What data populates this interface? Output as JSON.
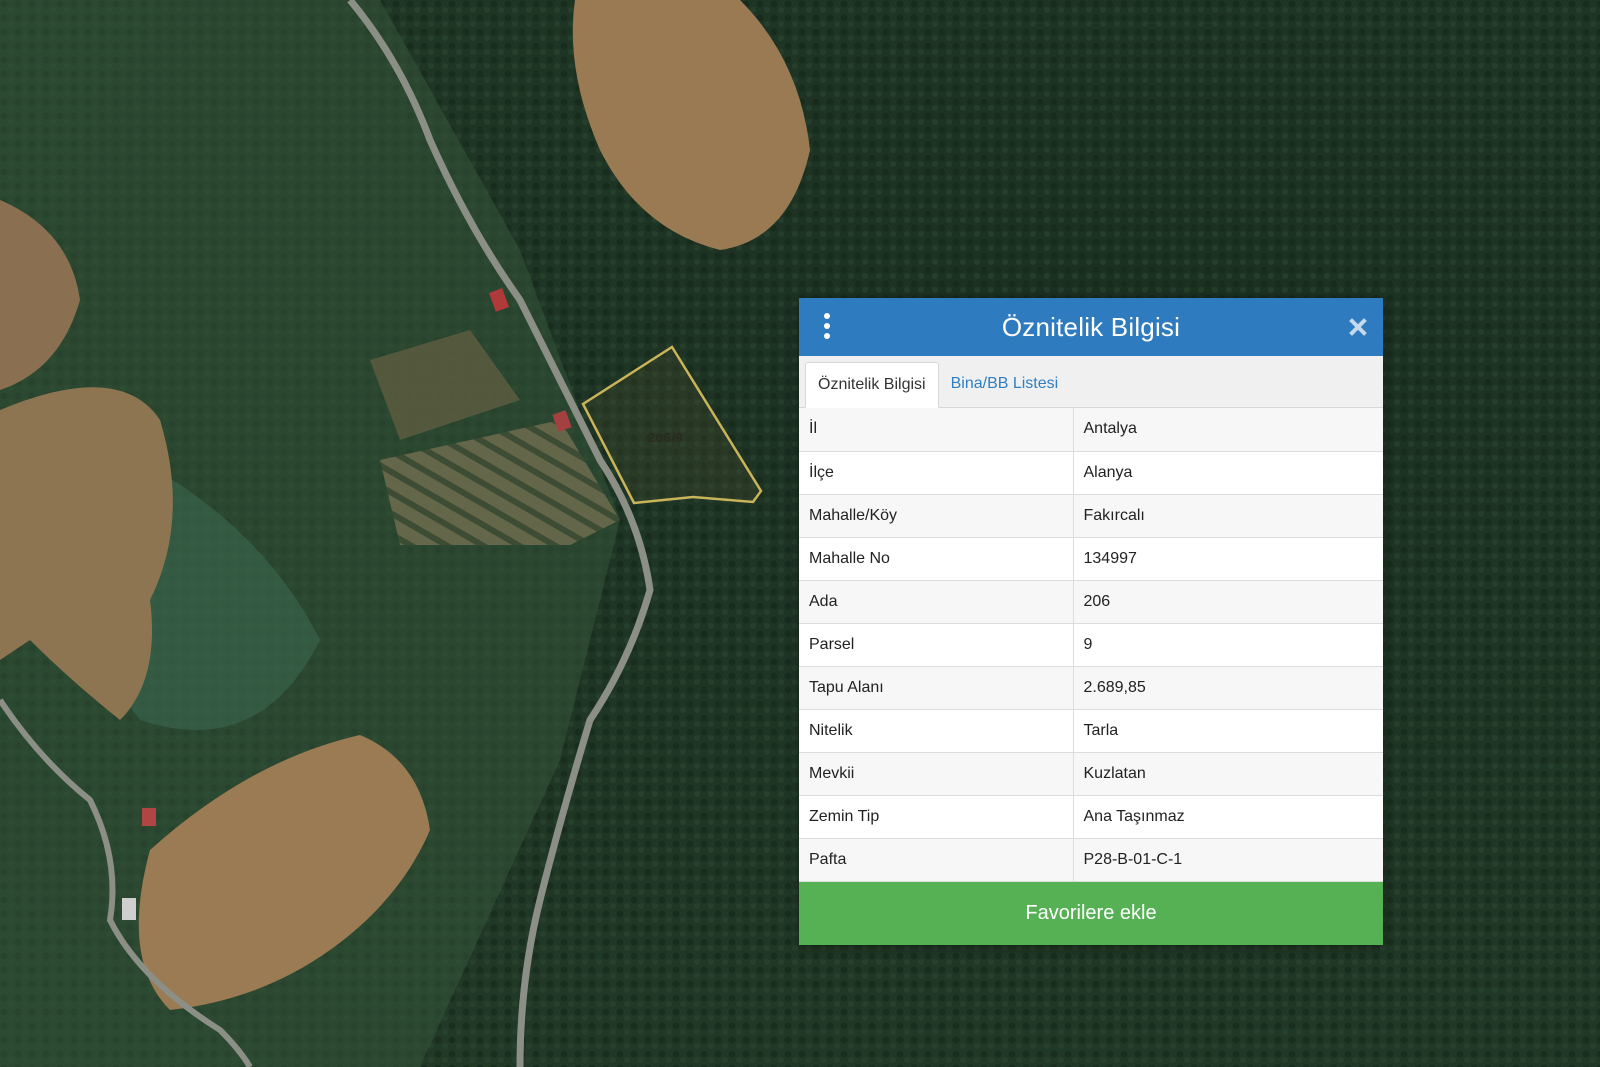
{
  "map": {
    "parcel_label": "206/9"
  },
  "panel": {
    "title": "Öznitelik Bilgisi",
    "menu_icon": "vertical-dots-icon",
    "close_icon": "close-icon",
    "header_color": "#2e7bc0",
    "tabs": [
      {
        "label": "Öznitelik Bilgisi",
        "active": true
      },
      {
        "label": "Bina/BB Listesi",
        "active": false
      }
    ],
    "attributes": [
      {
        "key": "İl",
        "value": "Antalya"
      },
      {
        "key": "İlçe",
        "value": "Alanya"
      },
      {
        "key": "Mahalle/Köy",
        "value": "Fakırcalı"
      },
      {
        "key": "Mahalle No",
        "value": "134997"
      },
      {
        "key": "Ada",
        "value": "206"
      },
      {
        "key": "Parsel",
        "value": "9"
      },
      {
        "key": "Tapu Alanı",
        "value": "2.689,85"
      },
      {
        "key": "Nitelik",
        "value": "Tarla"
      },
      {
        "key": "Mevkii",
        "value": "Kuzlatan"
      },
      {
        "key": "Zemin Tip",
        "value": "Ana Taşınmaz"
      },
      {
        "key": "Pafta",
        "value": "P28-B-01-C-1"
      }
    ],
    "favorite_button": "Favorilere ekle",
    "button_color": "#55b153"
  }
}
